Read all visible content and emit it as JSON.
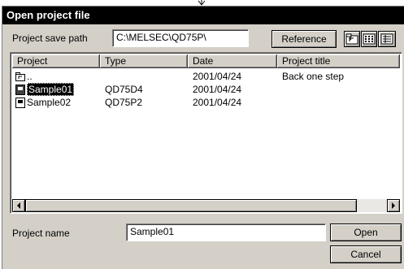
{
  "dialog": {
    "title": "Open project file",
    "save_path": {
      "label": "Project save path",
      "value": "C:\\MELSEC\\QD75P\\"
    },
    "buttons": {
      "reference": "Reference",
      "open": "Open",
      "cancel": "Cancel"
    },
    "toolbar_icons": [
      "up-one-level-icon",
      "list-view-icon",
      "details-view-icon"
    ],
    "list": {
      "columns": [
        "Project",
        "Type",
        "Date",
        "Project title"
      ],
      "rows": [
        {
          "project": "..",
          "type": "",
          "date": "2001/04/24",
          "title": "Back one step",
          "icon": "up-folder-icon",
          "selected": false
        },
        {
          "project": "Sample01",
          "type": "QD75D4",
          "date": "2001/04/24",
          "title": "",
          "icon": "project-file-icon",
          "selected": true
        },
        {
          "project": "Sample02",
          "type": "QD75P2",
          "date": "2001/04/24",
          "title": "",
          "icon": "project-file-icon",
          "selected": false
        }
      ]
    },
    "project_name": {
      "label": "Project name",
      "value": "Sample01"
    }
  }
}
